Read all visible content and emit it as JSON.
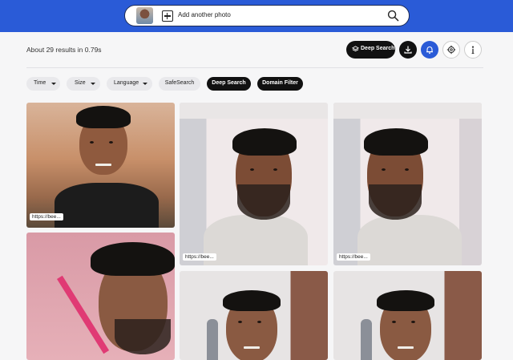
{
  "search": {
    "add_label": "Add another photo"
  },
  "results_summary": "About 29 results in 0.79s",
  "toolbar": {
    "deep_search_label": "Deep Search",
    "buttons": [
      "download-icon",
      "alert-icon",
      "settings-icon",
      "info-icon"
    ]
  },
  "filters": [
    {
      "label": "Time",
      "dropdown": true
    },
    {
      "label": "Size",
      "dropdown": true
    },
    {
      "label": "Language",
      "dropdown": true
    },
    {
      "label": "SafeSearch",
      "dropdown": false
    },
    {
      "label": "Deep Search",
      "dropdown": false,
      "active": true
    },
    {
      "label": "Domain Filter",
      "dropdown": false,
      "active": true
    }
  ],
  "results": [
    {
      "url_label": "https://bee..."
    },
    {
      "url_label": "https://bee..."
    },
    {
      "url_label": "https://bee..."
    },
    {
      "url_label": ""
    },
    {
      "url_label": ""
    },
    {
      "url_label": ""
    }
  ],
  "colors": {
    "header_blue": "#2a5bd7",
    "dark_button": "#111111",
    "chip_light": "#e9e9ec"
  }
}
